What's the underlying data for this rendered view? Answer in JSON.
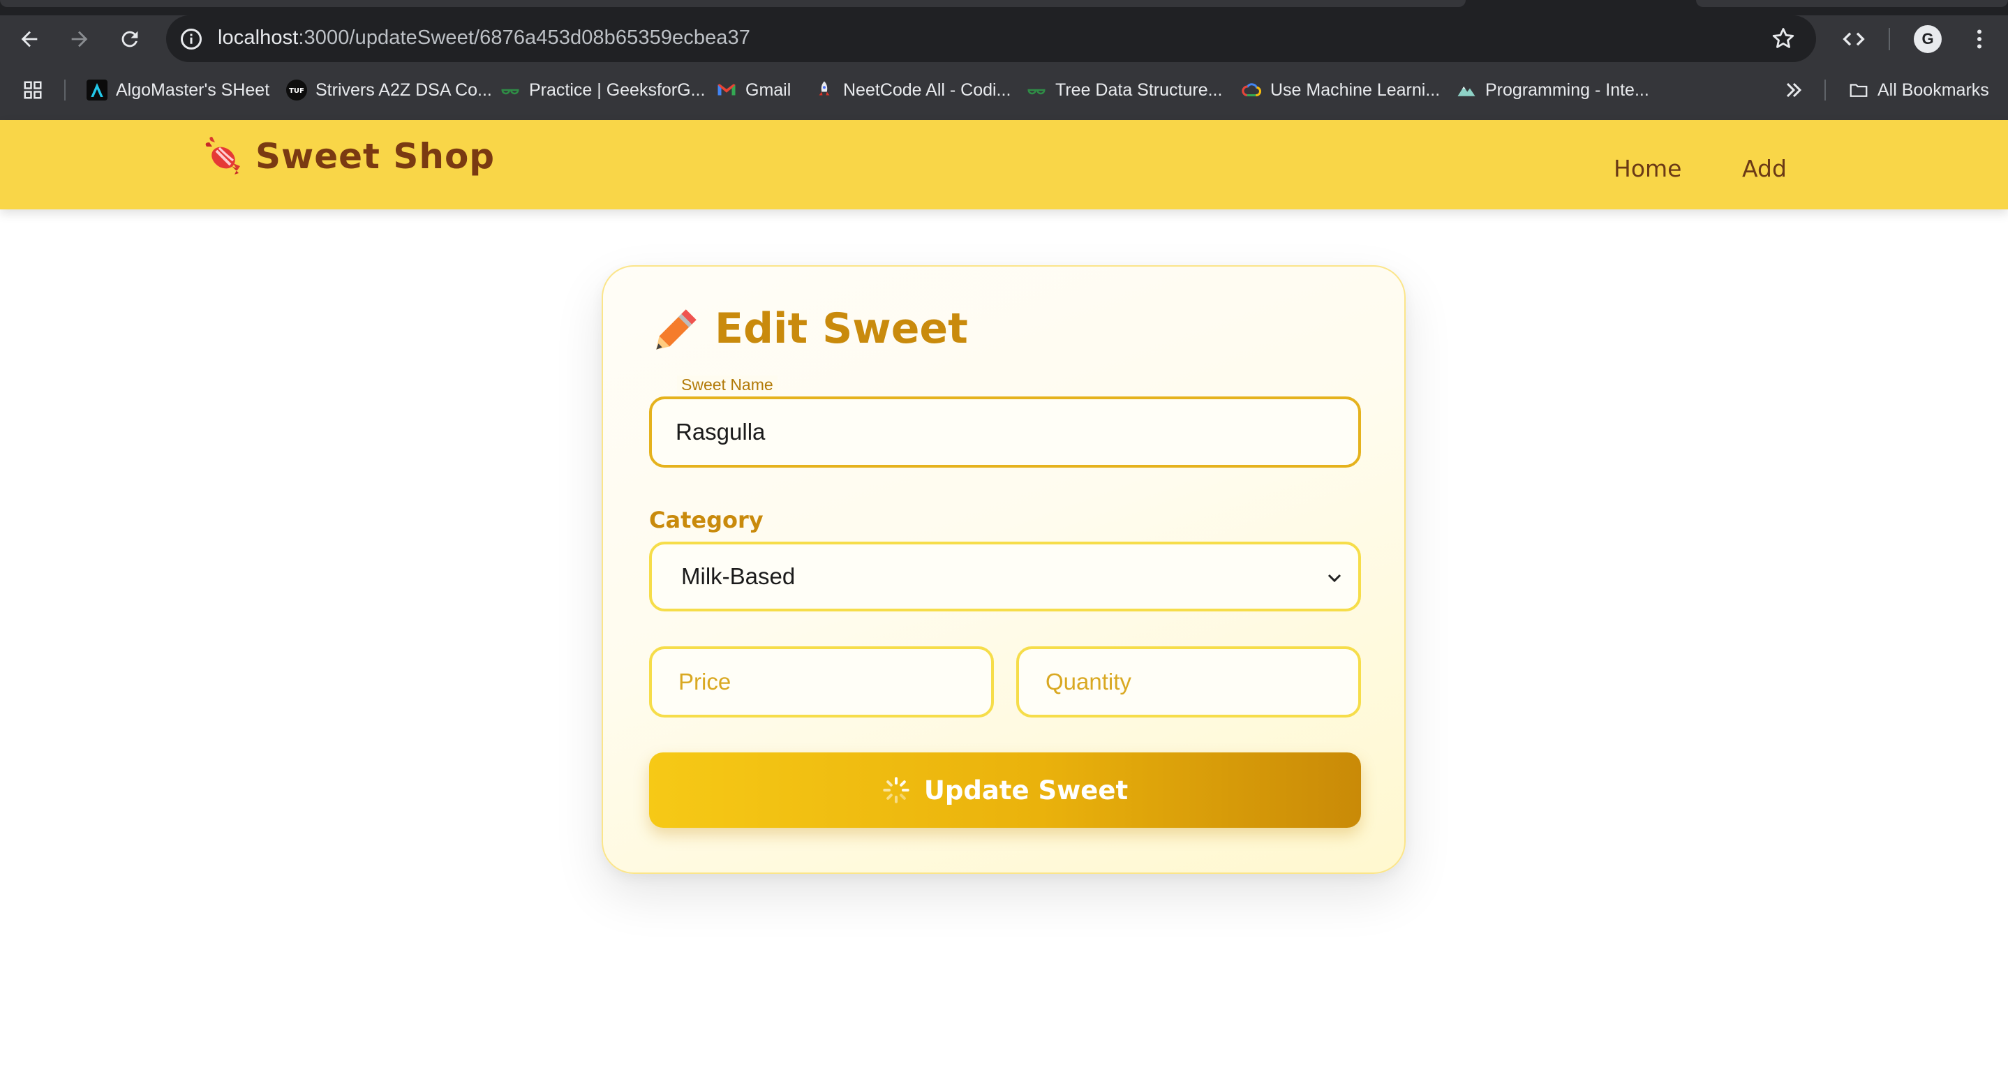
{
  "browser": {
    "url_host": "localhost",
    "url_path": ":3000/updateSweet/6876a453d08b65359ecbea37",
    "avatar_letter": "G",
    "bookmarks": [
      {
        "label": "AlgoMaster's SHeet",
        "icon": "algomaster-icon"
      },
      {
        "label": "Strivers A2Z DSA Co...",
        "icon": "tuf-icon"
      },
      {
        "label": "Practice | GeeksforG...",
        "icon": "gfg-icon"
      },
      {
        "label": "Gmail",
        "icon": "gmail-icon"
      },
      {
        "label": "NeetCode All - Codi...",
        "icon": "rocket-icon"
      },
      {
        "label": "Tree Data Structure...",
        "icon": "gfg-icon"
      },
      {
        "label": "Use Machine Learni...",
        "icon": "google-cloud-icon"
      },
      {
        "label": "Programming - Inte...",
        "icon": "mountain-icon"
      }
    ],
    "all_bookmarks": "All Bookmarks"
  },
  "app": {
    "brand": "Sweet Shop",
    "nav": {
      "home": "Home",
      "add": "Add"
    }
  },
  "form": {
    "title": "Edit Sweet",
    "name_label": "Sweet Name",
    "name_value": "Rasgulla",
    "category_label": "Category",
    "category_value": "Milk-Based",
    "price_placeholder": "Price",
    "quantity_placeholder": "Quantity",
    "submit_label": "Update Sweet"
  },
  "colors": {
    "header_bg": "#f9d648",
    "brand_text": "#7a3a12",
    "accent": "#c98a0c",
    "input_border": "#f3cc3b",
    "button_start": "#f6c916",
    "button_end": "#c98a07"
  }
}
